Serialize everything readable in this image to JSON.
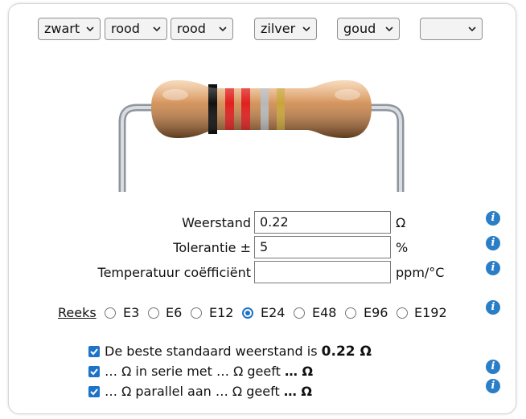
{
  "bands": {
    "band1": "zwart",
    "band2": "rood",
    "band3": "rood",
    "multiplier": "zilver",
    "tolerance": "goud",
    "tempco": ""
  },
  "band_colors": {
    "band1": "#111111",
    "band2": "#e02020",
    "band3": "#e02020",
    "multiplier": "#b8b8b8",
    "tolerance": "#c8a43a"
  },
  "fields": {
    "resistance_label": "Weerstand",
    "resistance_value": "0.22",
    "resistance_unit": "Ω",
    "tolerance_label": "Tolerantie ±",
    "tolerance_value": "5",
    "tolerance_unit": "%",
    "tempco_label": "Temperatuur coëfficiënt",
    "tempco_value": "",
    "tempco_unit": "ppm/°C"
  },
  "series": {
    "label": "Reeks",
    "options": [
      "E3",
      "E6",
      "E12",
      "E24",
      "E48",
      "E96",
      "E192"
    ],
    "selected": "E24"
  },
  "results": {
    "best_text": "De beste standaard weerstand is",
    "best_value": "0.22 Ω",
    "serial_text": "… Ω in serie met … Ω geeft",
    "serial_value": "… Ω",
    "parallel_text": "… Ω parallel aan … Ω geeft",
    "parallel_value": "… Ω"
  },
  "colors": {
    "accent": "#1e73c8",
    "info": "#2a7ec6"
  },
  "icons": {
    "info": "info-icon",
    "dropdown": "chevron-down-icon",
    "checkbox": "checkmark-icon"
  }
}
